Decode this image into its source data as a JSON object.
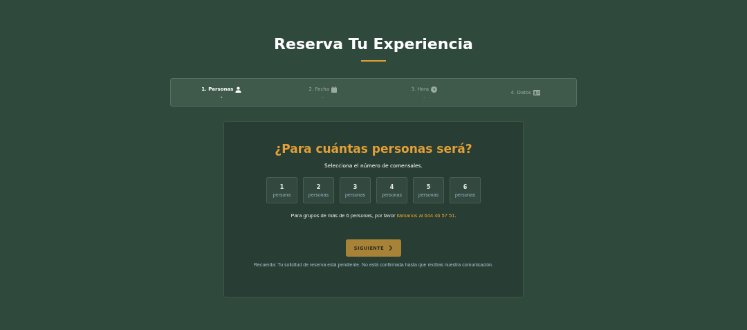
{
  "title": "Reserva Tu Experiencia",
  "steps": [
    {
      "label": "1. Personas",
      "kind": "person",
      "value": "-",
      "selected": true
    },
    {
      "label": "2. Fecha",
      "kind": "calendar",
      "value": "-",
      "selected": false
    },
    {
      "label": "3. Hora",
      "kind": "clock",
      "value": "-",
      "selected": false
    },
    {
      "label": "4. Datos",
      "kind": "card",
      "selected": false
    }
  ],
  "card": {
    "heading": "¿Para cuántas personas será?",
    "subtitle": "Selecciona el número de comensales.",
    "options": [
      {
        "number": "1",
        "unit": "persona",
        "selected": false
      },
      {
        "number": "2",
        "unit": "personas",
        "selected": false
      },
      {
        "number": "3",
        "unit": "personas",
        "selected": false
      },
      {
        "number": "4",
        "unit": "personas",
        "selected": false
      },
      {
        "number": "5",
        "unit": "personas",
        "selected": false
      },
      {
        "number": "6",
        "unit": "personas",
        "selected": false
      }
    ],
    "note": {
      "text": "Para grupos de más de 6 personas, por favor",
      "link": "llámanos al 644 46 57 51",
      "end": "."
    },
    "button": "SIGUIENTE",
    "reminder": "Recuerda: Tu solicitud de reserva está pendiente. No está confirmada hasta que recibas nuestra comunicación."
  }
}
